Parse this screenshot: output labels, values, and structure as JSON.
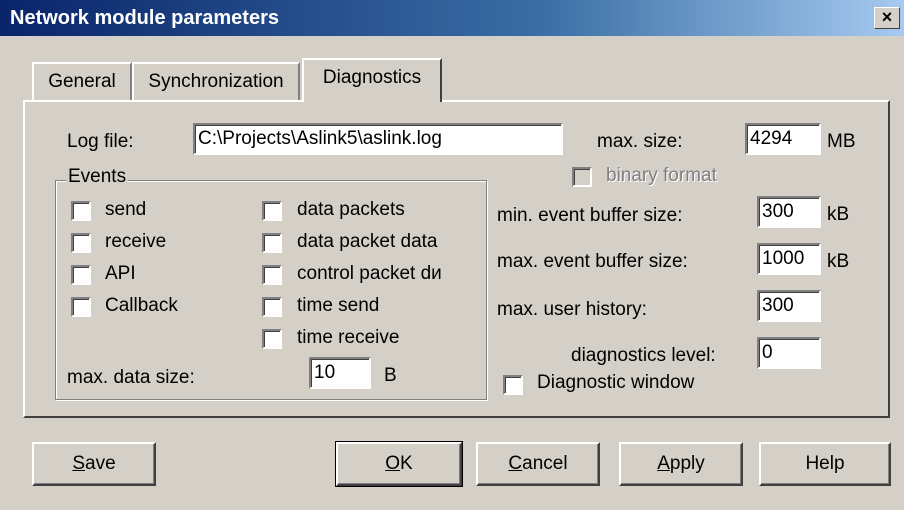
{
  "window": {
    "title": "Network module parameters",
    "close": "×"
  },
  "tabs": [
    {
      "label": "General",
      "active": false
    },
    {
      "label": "Synchronization",
      "active": false
    },
    {
      "label": "Diagnostics",
      "active": true
    }
  ],
  "log_file": {
    "label": "Log file:",
    "value": "C:\\Projects\\Aslink5\\aslink.log"
  },
  "max_size": {
    "label": "max. size:",
    "value": "4294",
    "unit": "MB"
  },
  "binary_format": {
    "label": "binary format",
    "checked": false,
    "enabled": false
  },
  "events": {
    "title": "Events",
    "col1": [
      {
        "label": "send",
        "checked": false
      },
      {
        "label": "receive",
        "checked": false
      },
      {
        "label": "API",
        "checked": false
      },
      {
        "label": "Callback",
        "checked": false
      }
    ],
    "col2": [
      {
        "label": "data packets",
        "checked": false
      },
      {
        "label": "data packet data",
        "checked": false
      },
      {
        "label": "control packet dи",
        "checked": false
      },
      {
        "label": "time send",
        "checked": false
      },
      {
        "label": "time receive",
        "checked": false
      }
    ],
    "max_data_size": {
      "label": "max. data size:",
      "value": "10",
      "unit": "B"
    }
  },
  "min_event_buffer": {
    "label": "min. event buffer size:",
    "value": "300",
    "unit": "kB"
  },
  "max_event_buffer": {
    "label": "max. event buffer size:",
    "value": "1000",
    "unit": "kB"
  },
  "max_user_history": {
    "label": "max. user history:",
    "value": "300"
  },
  "diagnostics_level": {
    "label": "diagnostics level:",
    "value": "0"
  },
  "diagnostic_window": {
    "label": "Diagnostic window",
    "checked": false
  },
  "buttons": {
    "save": {
      "first": "S",
      "rest": "ave"
    },
    "ok": {
      "first": "O",
      "rest": "K"
    },
    "cancel": {
      "first": "C",
      "rest": "ancel"
    },
    "apply": {
      "first": "A",
      "rest": "pply"
    },
    "help": "Help"
  }
}
